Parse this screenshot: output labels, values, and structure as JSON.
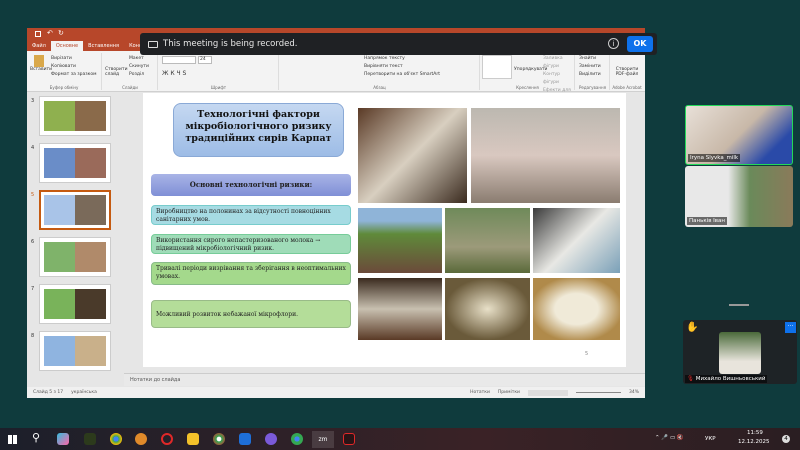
{
  "ppt": {
    "tabs": [
      "Файл",
      "Основне",
      "Вставлення",
      "Конструктор"
    ],
    "active_tab": "Основне",
    "ribbon": {
      "clipboard": {
        "paste": "Вставити",
        "cut": "Вирізати",
        "copy": "Копіювати",
        "format_painter": "Формат за зразком",
        "label": "Буфер обміну"
      },
      "slides": {
        "new_slide": "Створити слайд",
        "layout": "Макет",
        "reset": "Скинути",
        "section": "Розділ",
        "label": "Слайди"
      },
      "font": {
        "size": "24",
        "label": "Шрифт"
      },
      "paragraph": {
        "text_direction": "Напрямок тексту",
        "align_text": "Вирівняти текст",
        "smartart": "Перетворити на об'єкт SmartArt",
        "label": "Абзац"
      },
      "drawing": {
        "arrange": "Упорядкувати",
        "quick_styles": "Експрес-стилі",
        "fill": "Заливка фігури",
        "outline": "Контур фігури",
        "effects": "Ефекти для фігур",
        "label": "Креслення"
      },
      "editing": {
        "find": "Знайти",
        "replace": "Замінити",
        "select": "Виділити",
        "label": "Редагування"
      },
      "acrobat": {
        "create_pdf": "Створити PDF-файл",
        "label": "Adobe Acrobat"
      }
    },
    "thumbnails": [
      "3",
      "4",
      "5",
      "6",
      "7",
      "8"
    ],
    "selected_slide": "5",
    "slide": {
      "title": "Технологічні фактори мікробіологічного ризику традиційних сирів Карпат",
      "subtitle": "Основні технологічні ризики:",
      "risks": [
        "Виробництво на полонинах за відсутності повноцінних санітарних умов.",
        "Використання сирого непастеризованого молока → підвищений мікробіологічний ризик.",
        "Тривалі періоди визрівання та зберігання в неоптимальних умовах.",
        "Можливий розвиток небажаної мікрофлори."
      ],
      "page_number": "5"
    },
    "notes_placeholder": "Нотатки до слайда",
    "status": {
      "slide_count": "Слайд 5 з 17",
      "language": "українська",
      "notes": "Нотатки",
      "comments": "Примітки",
      "zoom": "34%"
    }
  },
  "banner": {
    "text": "This meeting is being recorded.",
    "ok": "OK"
  },
  "zoom": {
    "participants": [
      "Iryna Slyvka_milk",
      "Паньків Іван"
    ],
    "self_name": "Михайло Вишньовський",
    "more": "···"
  },
  "taskbar": {
    "language": "УКР",
    "time": "11:59",
    "date": "12.12.2025",
    "notifications": "4",
    "zoom_app": "zm"
  },
  "colors": {
    "ppt_accent": "#b7472a",
    "zoom_ok": "#0e71eb",
    "active_speaker": "#23d959"
  }
}
